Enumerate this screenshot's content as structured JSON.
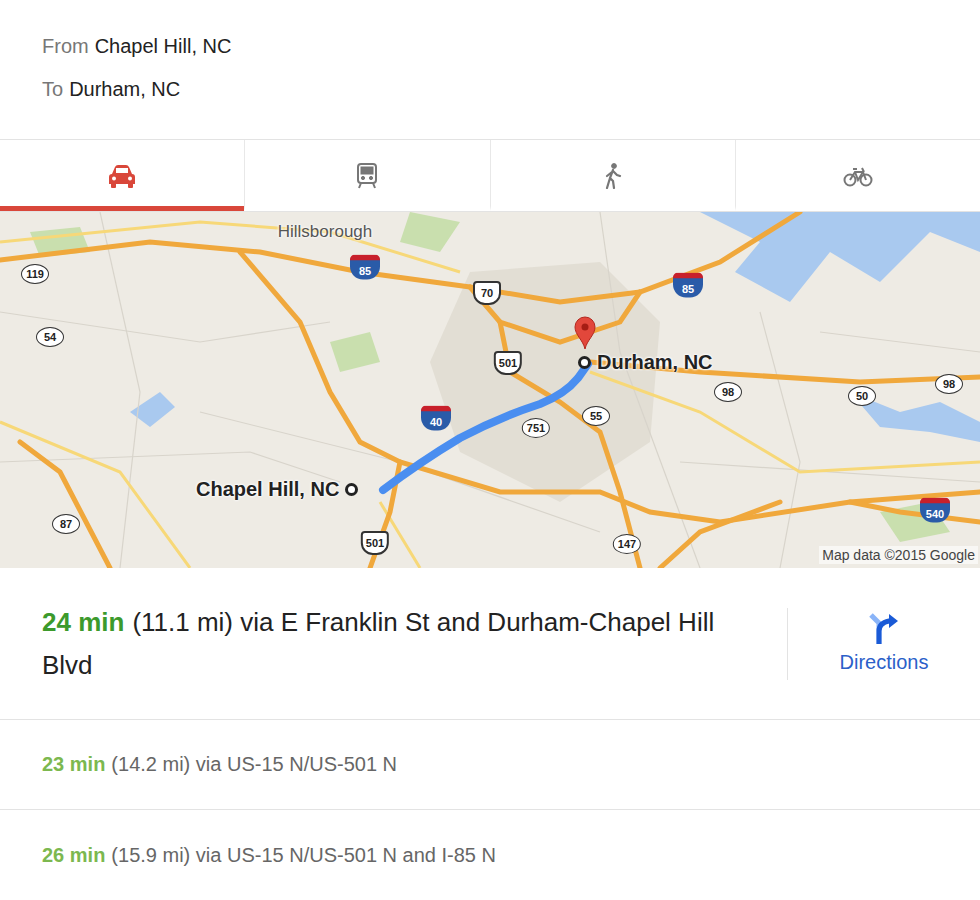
{
  "trip": {
    "from_label": "From",
    "from": "Chapel Hill, NC",
    "to_label": "To",
    "to": "Durham, NC"
  },
  "tabs": [
    {
      "kind": "car",
      "selected": true
    },
    {
      "kind": "transit",
      "selected": false
    },
    {
      "kind": "walk",
      "selected": false
    },
    {
      "kind": "bike",
      "selected": false
    }
  ],
  "map": {
    "places": [
      {
        "name": "Hillsborough"
      }
    ],
    "shields": [
      {
        "number": "119",
        "kind": "state"
      },
      {
        "number": "54",
        "kind": "state"
      },
      {
        "number": "85",
        "kind": "interstate"
      },
      {
        "number": "70",
        "kind": "us"
      },
      {
        "number": "85",
        "kind": "interstate"
      },
      {
        "number": "501",
        "kind": "us"
      },
      {
        "number": "40",
        "kind": "interstate"
      },
      {
        "number": "751",
        "kind": "state"
      },
      {
        "number": "55",
        "kind": "state"
      },
      {
        "number": "98",
        "kind": "state"
      },
      {
        "number": "50",
        "kind": "state"
      },
      {
        "number": "98",
        "kind": "state"
      },
      {
        "number": "87",
        "kind": "state"
      },
      {
        "number": "501",
        "kind": "us"
      },
      {
        "number": "147",
        "kind": "state"
      },
      {
        "number": "540",
        "kind": "interstate"
      }
    ],
    "origin": "Chapel Hill, NC",
    "destination": "Durham, NC",
    "attribution": "Map data ©2015 Google"
  },
  "routes": [
    {
      "time": "24 min",
      "detail": "(11.1 mi) via E Franklin St and Durham-Chapel Hill Blvd",
      "selected": true
    },
    {
      "time": "23 min",
      "detail": "(14.2 mi) via US-15 N/US-501 N",
      "selected": false
    },
    {
      "time": "26 min",
      "detail": "(15.9 mi) via US-15 N/US-501 N and I-85 N",
      "selected": false
    }
  ],
  "directions_button": {
    "label": "Directions"
  }
}
